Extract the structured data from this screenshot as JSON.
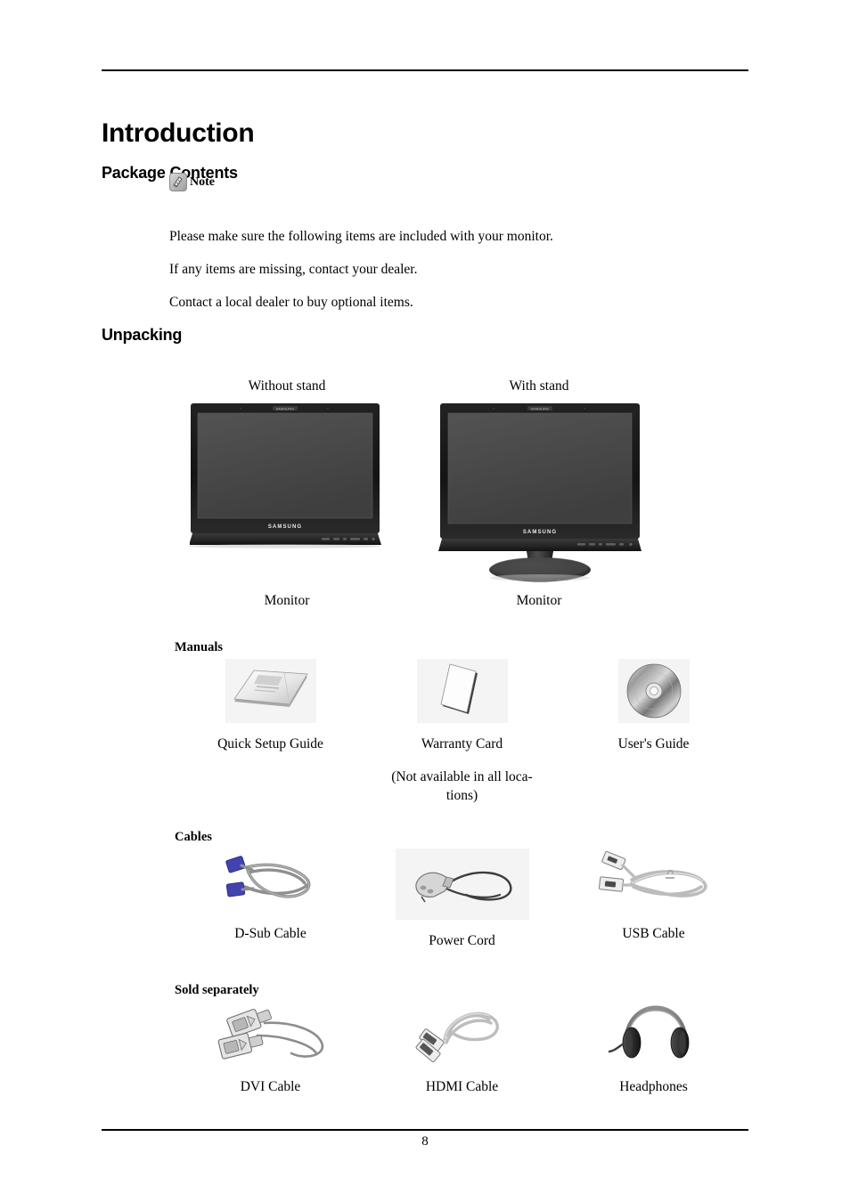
{
  "document": {
    "title": "Introduction",
    "page_number": "8",
    "footer_rule": true
  },
  "package_contents": {
    "heading": "Package Contents",
    "note": {
      "icon": "note-pen-icon",
      "label": "Note"
    },
    "paragraphs": [
      "Please make sure the following items are included with your monitor.",
      "If any items are missing, contact your dealer.",
      "Contact a local dealer to buy optional items."
    ]
  },
  "unpacking": {
    "heading": "Unpacking",
    "monitors": [
      {
        "top_caption": "Without stand",
        "bottom_caption": "Monitor",
        "icon": "monitor-without-stand-icon",
        "brand": "SAMSUNG",
        "has_stand": false
      },
      {
        "top_caption": "With stand",
        "bottom_caption": "Monitor",
        "icon": "monitor-with-stand-icon",
        "brand": "SAMSUNG",
        "has_stand": true
      }
    ],
    "sections": [
      {
        "label": "Manuals",
        "items": [
          {
            "label": "Quick Setup Guide",
            "icon": "booklet-icon",
            "sub": "",
            "boxed": true
          },
          {
            "label": "Warranty Card",
            "icon": "card-icon",
            "sub": "(Not available in all loca-\ntions)",
            "boxed": true
          },
          {
            "label": "User's Guide",
            "icon": "cd-disc-icon",
            "sub": "",
            "boxed": true
          }
        ]
      },
      {
        "label": "Cables",
        "items": [
          {
            "label": "D-Sub Cable",
            "icon": "dsub-cable-icon",
            "sub": "",
            "boxed": false
          },
          {
            "label": "Power Cord",
            "icon": "power-cord-icon",
            "sub": "",
            "boxed": true
          },
          {
            "label": "USB Cable",
            "icon": "usb-cable-icon",
            "sub": "",
            "boxed": false
          }
        ]
      },
      {
        "label": "Sold separately",
        "items": [
          {
            "label": "DVI Cable",
            "icon": "dvi-cable-icon",
            "sub": "",
            "boxed": false
          },
          {
            "label": "HDMI Cable",
            "icon": "hdmi-cable-icon",
            "sub": "",
            "boxed": false
          },
          {
            "label": "Headphones",
            "icon": "headphones-icon",
            "sub": "",
            "boxed": false
          }
        ]
      }
    ]
  },
  "colors": {
    "text": "#000000",
    "rule": "#000000",
    "monitor_bezel": "#1a1a1a",
    "monitor_screen": "#4a4a4a",
    "art_background": "#f4f4f4",
    "connector_blue": "#4343b0",
    "cable_gray": "#9a9a9a"
  }
}
